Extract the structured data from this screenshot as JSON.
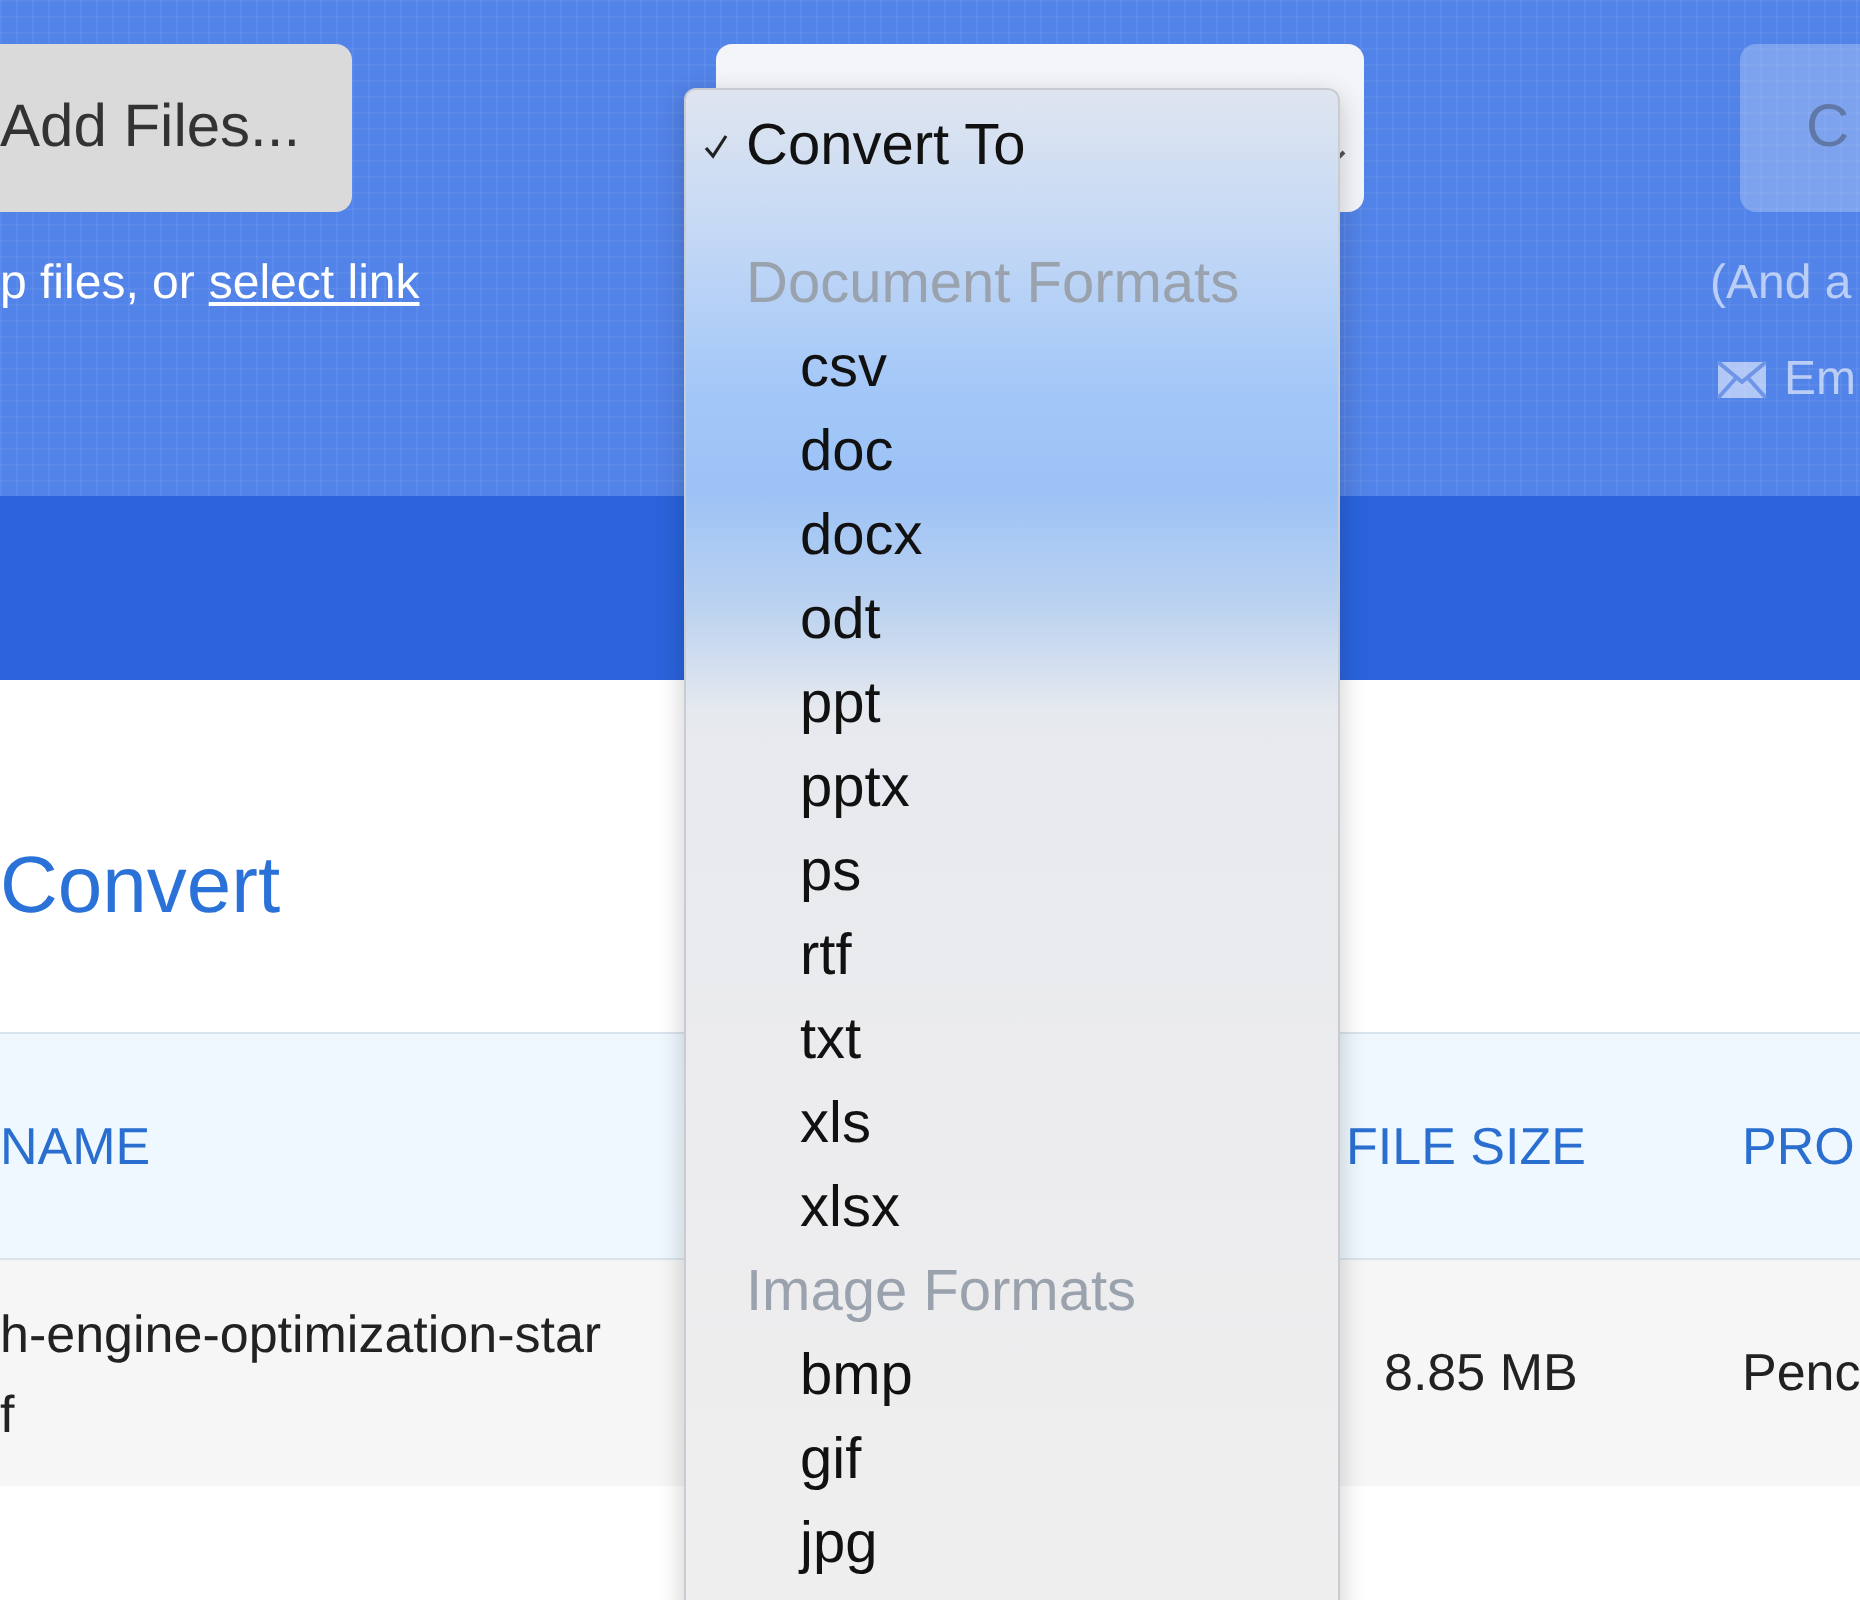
{
  "toolbar": {
    "add_button": "Add Files...",
    "drop_hint": "p files, or",
    "select_link": "select link",
    "convert_button": "C",
    "note": "(And a",
    "email": "Em"
  },
  "heading": "Convert",
  "table": {
    "columns": [
      "NAME",
      "FILE SIZE",
      "PRO"
    ],
    "rows": [
      {
        "name_lines": [
          "h-engine-optimization-star",
          "f"
        ],
        "size": "8.85 MB",
        "status": "Penc"
      }
    ]
  },
  "dropdown": {
    "items": [
      {
        "kind": "option",
        "label": "Convert To",
        "selected": true
      },
      {
        "kind": "group",
        "label": "Document Formats"
      },
      {
        "kind": "option",
        "label": "csv",
        "selected": false
      },
      {
        "kind": "option",
        "label": "doc",
        "selected": false
      },
      {
        "kind": "option",
        "label": "docx",
        "selected": false
      },
      {
        "kind": "option",
        "label": "odt",
        "selected": false
      },
      {
        "kind": "option",
        "label": "ppt",
        "selected": false
      },
      {
        "kind": "option",
        "label": "pptx",
        "selected": false
      },
      {
        "kind": "option",
        "label": "ps",
        "selected": false
      },
      {
        "kind": "option",
        "label": "rtf",
        "selected": false
      },
      {
        "kind": "option",
        "label": "txt",
        "selected": false
      },
      {
        "kind": "option",
        "label": "xls",
        "selected": false
      },
      {
        "kind": "option",
        "label": "xlsx",
        "selected": false
      },
      {
        "kind": "group",
        "label": "Image Formats"
      },
      {
        "kind": "option",
        "label": "bmp",
        "selected": false
      },
      {
        "kind": "option",
        "label": "gif",
        "selected": false
      },
      {
        "kind": "option",
        "label": "jpg",
        "selected": false
      }
    ]
  }
}
